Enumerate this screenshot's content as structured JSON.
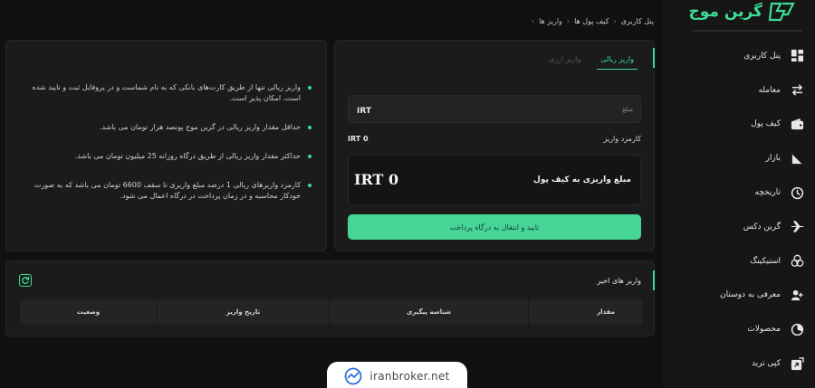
{
  "brand": {
    "name": "گرین موج",
    "accent": "#3ddc97"
  },
  "breadcrumb": [
    "پنل کاربری",
    "کیف پول ها",
    "واریز ها"
  ],
  "sidebar": {
    "items": [
      {
        "label": "پنل کاربری",
        "icon": "dashboard-icon"
      },
      {
        "label": "معامله",
        "icon": "swap-arrows-icon"
      },
      {
        "label": "کیف پول",
        "icon": "wallet-icon"
      },
      {
        "label": "بازار",
        "icon": "market-arrow-icon"
      },
      {
        "label": "تاریخچه",
        "icon": "history-clock-icon"
      },
      {
        "label": "گرین دکس",
        "icon": "plane-icon"
      },
      {
        "label": "استیکینگ",
        "icon": "staking-circles-icon"
      },
      {
        "label": "معرفی به دوستان",
        "icon": "referral-users-icon"
      },
      {
        "label": "محصولات",
        "icon": "products-icon"
      },
      {
        "label": "کپی ترید",
        "icon": "copy-trade-icon"
      }
    ]
  },
  "deposit": {
    "tab_rial": "واریز ریالی",
    "tab_crypto": "واریز ارزی",
    "amount_label": "مبلغ",
    "amount_value": "IRT",
    "fee_label": "کارمزد واریز",
    "fee_value": "IRT 0",
    "total_label": "مبلغ واریزی به کیف پول",
    "total_value": "IRT 0",
    "submit_label": "تایید و انتقال به درگاه پرداخت"
  },
  "info": {
    "items": [
      "واریز ریالی تنها از طریق کارت‌های بانکی که به نام شماست و در پروفایل ثبت و تایید شده است، امکان پذیر است.",
      "حداقل مقدار واریز ریالی در گرین موج پونصد هزار تومان می باشد.",
      "حداکثر مقدار واریز ریالی از طریق درگاه روزانه 25 میلیون تومان می باشد.",
      "کارمزد واریزهای ریالی 1 درصد مبلغ واریزی تا سقف 6600 تومان می باشد که به صورت خودکار محاسبه و در زمان پرداخت در درگاه اعمال می شود."
    ]
  },
  "recent": {
    "title": "واریز های اخیر",
    "columns": [
      "مقدار",
      "شناسه پیگیری",
      "تاریخ واریز",
      "وضعیت"
    ]
  },
  "watermark": {
    "text": "iranbroker.net"
  }
}
